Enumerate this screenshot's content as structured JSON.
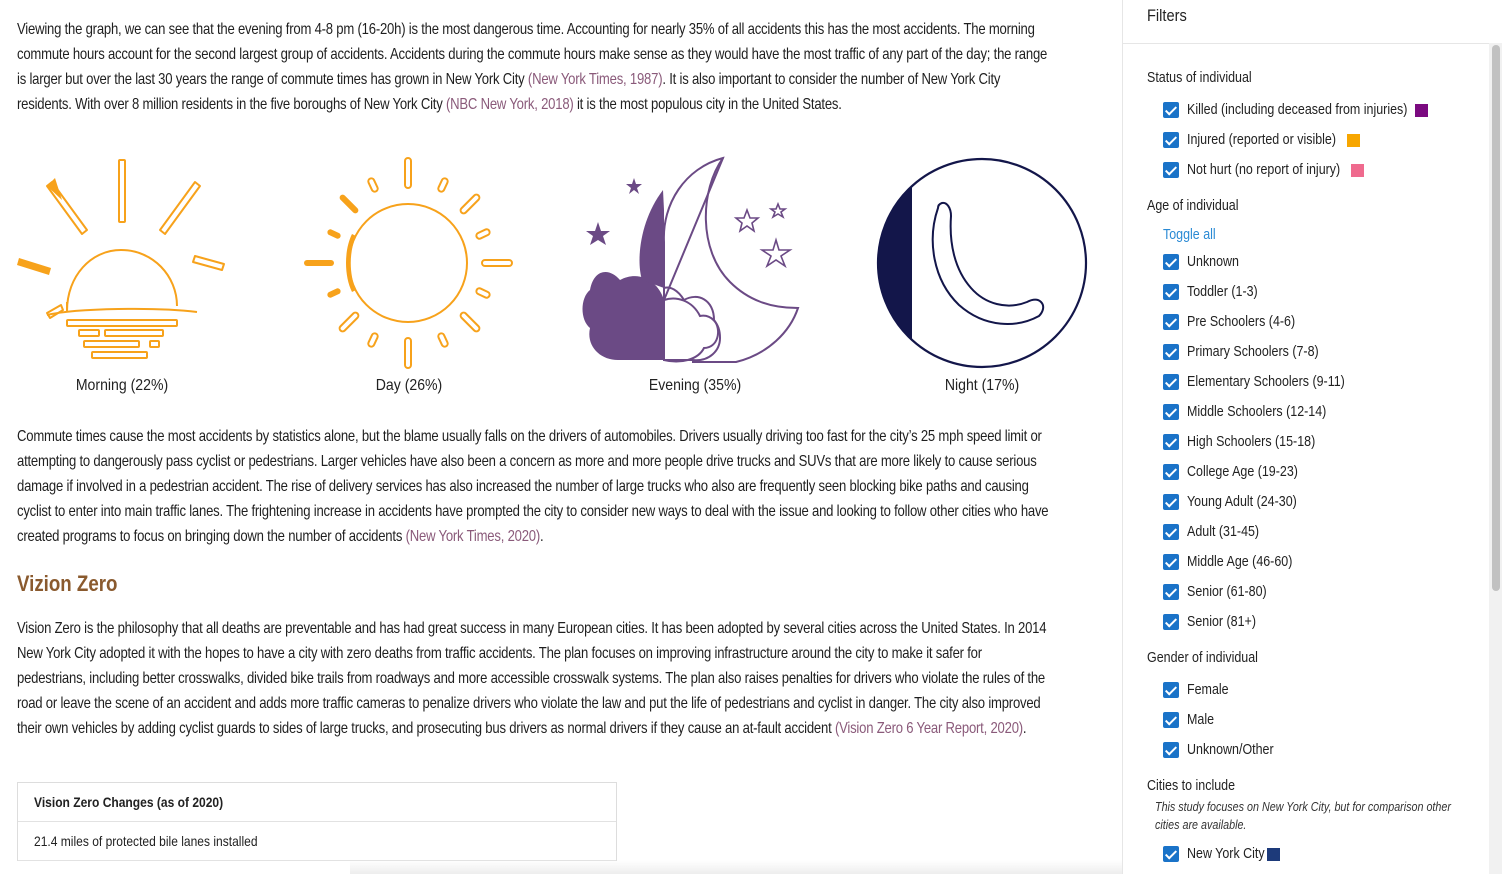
{
  "main": {
    "p1": {
      "t1": "Viewing the graph, we can see that the evening from 4-8 pm (16-20h) is the most dangerous time. Accounting for nearly 35% of all accidents this has the most accidents. The morning commute hours account for the second largest group of accidents. Accidents during the commute hours make sense as they would have the most traffic of any part of the day; the range is larger but over the last 30 years the range of commute times has grown in New York City ",
      "c1": "(New York Times, 1987)",
      "t2": ". It is also important to consider the number of New York City residents. With over 8 million residents in the five boroughs of New York City ",
      "c2": "(NBC New York, 2018)",
      "t3": " it is the most populous city in the United States."
    },
    "icons": [
      {
        "name": "Morning",
        "label": "Morning (22%)",
        "icon": "sunrise-icon",
        "color": "#f7a21b"
      },
      {
        "name": "Day",
        "label": "Day (26%)",
        "icon": "sun-icon",
        "color": "#f7a21b"
      },
      {
        "name": "Evening",
        "label": "Evening (35%)",
        "icon": "moon-clouds-stars-icon",
        "color": "#6b4a85"
      },
      {
        "name": "Night",
        "label": "Night (17%)",
        "icon": "crescent-moon-icon",
        "color": "#13164a"
      }
    ],
    "p2": {
      "t1": "Commute times cause the most accidents by statistics alone, but the blame usually falls on the drivers of automobiles. Drivers usually driving too fast for the city’s 25 mph speed limit or attempting to dangerously pass cyclist or pedestrians. Larger vehicles have also been a concern as more and more people drive trucks and SUVs that are more likely to cause serious damage if involved in a pedestrian accident. The rise of delivery services has also increased the number of large trucks who also are frequently seen blocking bike paths and causing cyclist to enter into main traffic lanes. The frightening increase in accidents have prompted the city to consider new ways to deal with the issue and looking to follow other cities who have created programs to focus on bringing down the number of accidents ",
      "c1": "(New York Times, 2020)",
      "t2": "."
    },
    "vz_heading": "Vizion Zero",
    "p3": {
      "t1": "Vision Zero is the philosophy that all deaths are preventable and has had great success in many European cities. It has been adopted by several cities across the United States. In 2014 New York City adopted it with the hopes to have a city with zero deaths from traffic accidents. The plan focuses on improving infrastructure around the city to make it safer for pedestrians, including better crosswalks, divided bike trails from roadways and more accessible crosswalk systems. The plan also raises penalties for drivers who violate the rules of the road or leave the scene of an accident and adds more traffic cameras to penalize drivers who violate the law and put the life of pedestrians and cyclist in danger. The city also improved their own vehicles by adding cyclist guards to sides of large trucks, and prosecuting bus drivers as normal drivers if they cause an at-fault accident ",
      "c1": "(Vision Zero 6 Year Report, 2020)",
      "t2": "."
    },
    "table": {
      "header": "Vision Zero Changes (as of 2020)",
      "rows": [
        "21.4 miles of protected bile lanes installed"
      ]
    }
  },
  "sidebar": {
    "title": "Filters",
    "status": {
      "label": "Status of individual",
      "items": [
        {
          "label": "Killed (including deceased from injuries)",
          "checked": true,
          "color": "#7b0a80"
        },
        {
          "label": "Injured (reported or visible)",
          "checked": true,
          "color": "#f7a600"
        },
        {
          "label": "Not hurt (no report of injury)",
          "checked": true,
          "color": "#ef6a8e"
        }
      ]
    },
    "age": {
      "label": "Age of individual",
      "toggle": "Toggle all",
      "items": [
        {
          "label": "Unknown",
          "checked": true
        },
        {
          "label": "Toddler (1-3)",
          "checked": true
        },
        {
          "label": "Pre Schoolers (4-6)",
          "checked": true
        },
        {
          "label": "Primary Schoolers (7-8)",
          "checked": true
        },
        {
          "label": "Elementary Schoolers (9-11)",
          "checked": true
        },
        {
          "label": "Middle Schoolers (12-14)",
          "checked": true
        },
        {
          "label": "High Schoolers (15-18)",
          "checked": true
        },
        {
          "label": "College Age (19-23)",
          "checked": true
        },
        {
          "label": "Young Adult (24-30)",
          "checked": true
        },
        {
          "label": "Adult (31-45)",
          "checked": true
        },
        {
          "label": "Middle Age (46-60)",
          "checked": true
        },
        {
          "label": "Senior (61-80)",
          "checked": true
        },
        {
          "label": "Senior (81+)",
          "checked": true
        }
      ]
    },
    "gender": {
      "label": "Gender of individual",
      "items": [
        {
          "label": "Female",
          "checked": true
        },
        {
          "label": "Male",
          "checked": true
        },
        {
          "label": "Unknown/Other",
          "checked": true
        }
      ]
    },
    "cities": {
      "label": "Cities to include",
      "note": "This study focuses on New York City, but for comparison other cities are available.",
      "items": [
        {
          "label": "New York City",
          "checked": true,
          "color": "#1d3a7a"
        }
      ]
    }
  }
}
